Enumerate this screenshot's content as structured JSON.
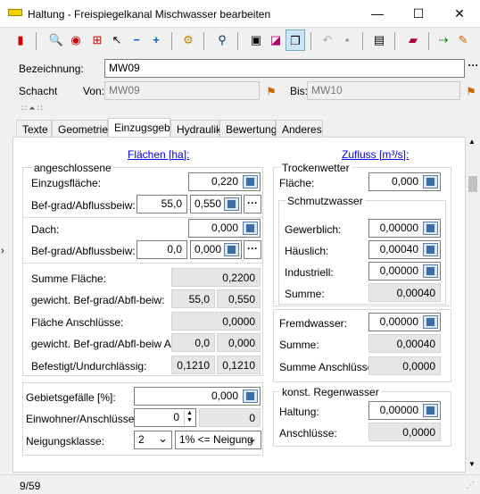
{
  "window": {
    "title": "Haltung - Freispiegelkanal Mischwasser bearbeiten",
    "minimize": "—",
    "maximize": "☐",
    "close": "✕"
  },
  "header": {
    "bezeichnung_label": "Bezeichnung:",
    "bezeichnung_value": "MW09",
    "schacht_label": "Schacht",
    "von_label": "Von:",
    "von_value": "MW09",
    "bis_label": "Bis:",
    "bis_value": "MW10",
    "more": "···"
  },
  "tabs": [
    "Texte",
    "Geometrie",
    "Einzugsgeb.",
    "Hydraulik",
    "Bewertung",
    "Anderes"
  ],
  "left": {
    "flaechen_link": "Flächen [ha]:",
    "angeschlossene_title": "angeschlossene",
    "einzugsflaeche_label": "Einzugsfläche:",
    "einzugsflaeche_value": "0,220",
    "befgrad1_label": "Bef-grad/Abflussbeiw:",
    "befgrad1_a": "55,0",
    "befgrad1_b": "0,550",
    "dach_label": "Dach:",
    "dach_value": "0,000",
    "befgrad2_label": "Bef-grad/Abflussbeiw:",
    "befgrad2_a": "0,0",
    "befgrad2_b": "0,000",
    "summe_flaeche_label": "Summe Fläche:",
    "summe_flaeche_value": "0,2200",
    "gewicht_label": "gewicht. Bef-grad/Abfl-beiw:",
    "gewicht_a": "55,0",
    "gewicht_b": "0,550",
    "flaeche_anschl_label": "Fläche Anschlüsse:",
    "flaeche_anschl_value": "0,0000",
    "gewicht_al_label": "gewicht. Bef-grad/Abfl-beiw AL:",
    "gewicht_al_a": "0,0",
    "gewicht_al_b": "0,000",
    "befestigt_label": "Befestigt/Undurchlässig:",
    "befestigt_a": "0,1210",
    "befestigt_b": "0,1210",
    "gebietsgefaelle_label": "Gebietsgefälle [%]:",
    "gebietsgefaelle_value": "0,000",
    "einwohner_label": "Einwohner/Anschlüsse:",
    "einwohner_value": "0",
    "einwohner_b": "0",
    "neigung_label": "Neigungsklasse:",
    "neigung_value": "2",
    "neigung_text": "1% <= Neigung"
  },
  "right": {
    "zufluss_link": "Zufluss [m³/s]:",
    "trocken_title": "Trockenwetter",
    "flaeche_label": "Fläche:",
    "flaeche_value": "0,000",
    "schmutz_title": "Schmutzwasser",
    "gewerblich_label": "Gewerblich:",
    "gewerblich_value": "0,00000",
    "haeuslich_label": "Häuslich:",
    "haeuslich_value": "0,00040",
    "industriell_label": "Industriell:",
    "industriell_value": "0,00000",
    "summe1_label": "Summe:",
    "summe1_value": "0,00040",
    "fremd_label": "Fremdwasser:",
    "fremd_value": "0,00000",
    "summe2_label": "Summe:",
    "summe2_value": "0,00040",
    "summe_anschl_label": "Summe Anschlüsse:",
    "summe_anschl_value": "0,0000",
    "regen_title": "konst. Regenwasser",
    "haltung_label": "Haltung:",
    "haltung_value": "0,00000",
    "anschluesse_label": "Anschlüsse:",
    "anschluesse_value": "0,0000"
  },
  "status": {
    "record": "9/59"
  }
}
